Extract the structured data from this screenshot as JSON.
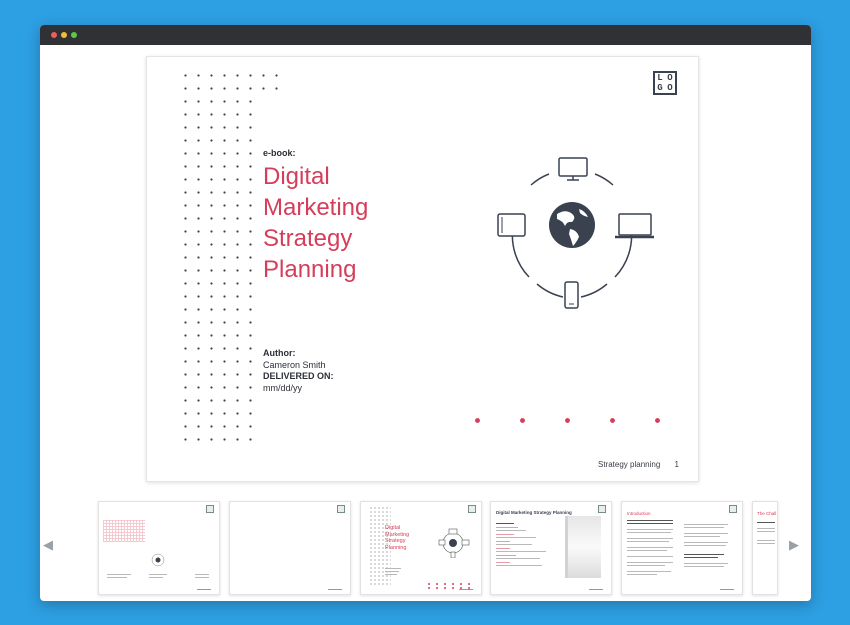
{
  "window": {
    "controls": [
      "close",
      "minimize",
      "zoom"
    ]
  },
  "page": {
    "label": "e-book:",
    "title_lines": [
      "Digital",
      "Marketing",
      "Strategy",
      "Planning"
    ],
    "author_label": "Author:",
    "author_name": "Cameron Smith",
    "delivered_label": "DELIVERED ON:",
    "delivered_value": "mm/dd/yy",
    "logo_letters": [
      "L",
      "O",
      "G",
      "O"
    ],
    "footer_text": "Strategy planning",
    "page_number": "1"
  },
  "colors": {
    "accent": "#d63d5a",
    "dark": "#3a4250",
    "background": "#2d9fe3"
  },
  "thumbnails": [
    {
      "label": ""
    },
    {
      "label": ""
    },
    {
      "title": [
        "Digital",
        "Marketing",
        "Strategy",
        "Planning"
      ]
    },
    {
      "title": [
        "Digital Marketing Strategy Planning"
      ]
    },
    {
      "title": [
        "Introduction"
      ]
    },
    {
      "title": [
        "The Chall"
      ]
    }
  ],
  "navigation": {
    "prev_icon": "chevron-left-icon",
    "next_icon": "chevron-right-icon"
  }
}
